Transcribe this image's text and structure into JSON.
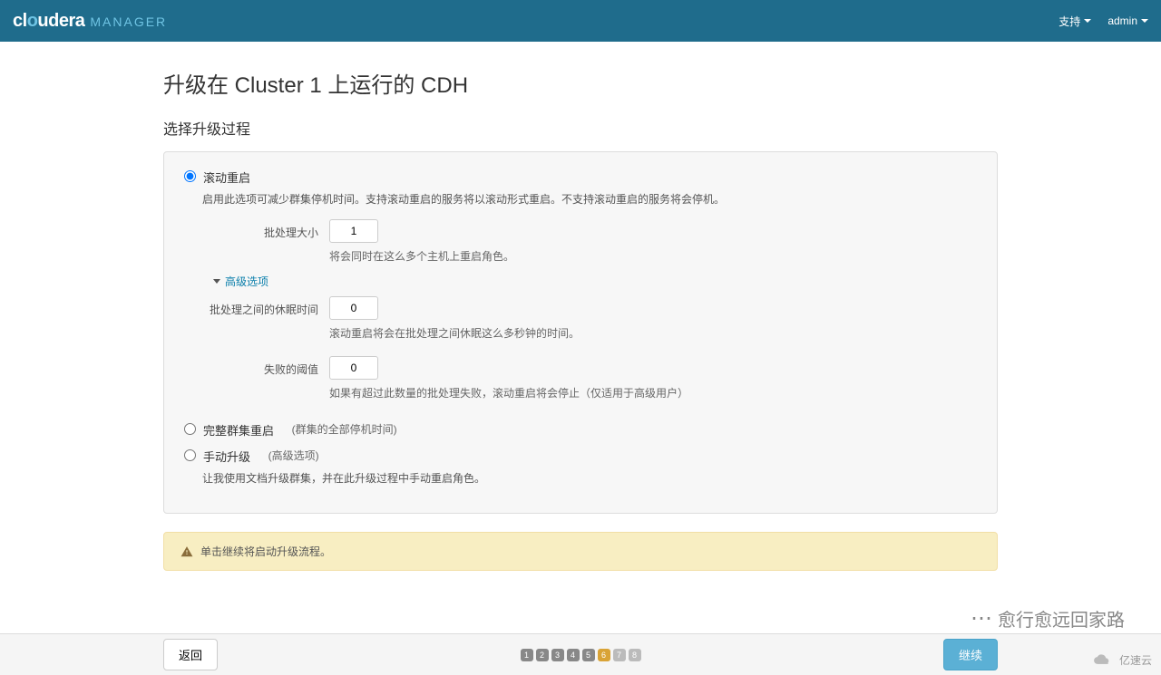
{
  "header": {
    "logo_main": "cloudera",
    "logo_sub": "MANAGER",
    "support": "支持",
    "admin": "admin"
  },
  "page": {
    "title": "升级在 Cluster 1 上运行的 CDH",
    "subtitle": "选择升级过程"
  },
  "options": {
    "rolling": {
      "label": "滚动重启",
      "desc": "启用此选项可减少群集停机时间。支持滚动重启的服务将以滚动形式重启。不支持滚动重启的服务将会停机。",
      "batch_label": "批处理大小",
      "batch_value": "1",
      "batch_help": "将会同时在这么多个主机上重启角色。",
      "adv_toggle": "高级选项",
      "sleep_label": "批处理之间的休眠时间",
      "sleep_value": "0",
      "sleep_help": "滚动重启将会在批处理之间休眠这么多秒钟的时间。",
      "fail_label": "失败的阈值",
      "fail_value": "0",
      "fail_help": "如果有超过此数量的批处理失败，滚动重启将会停止（仅适用于高级用户）"
    },
    "full": {
      "label": "完整群集重启",
      "hint": "(群集的全部停机时间)"
    },
    "manual": {
      "label": "手动升级",
      "hint": "(高级选项)",
      "desc": "让我使用文档升级群集，并在此升级过程中手动重启角色。"
    }
  },
  "alert": {
    "text": "单击继续将启动升级流程。"
  },
  "footer": {
    "back": "返回",
    "continue": "继续",
    "steps": [
      "1",
      "2",
      "3",
      "4",
      "5",
      "6",
      "7",
      "8"
    ],
    "current_step": 6
  },
  "watermark": {
    "wechat": "愈行愈远回家路",
    "brand": "亿速云"
  }
}
